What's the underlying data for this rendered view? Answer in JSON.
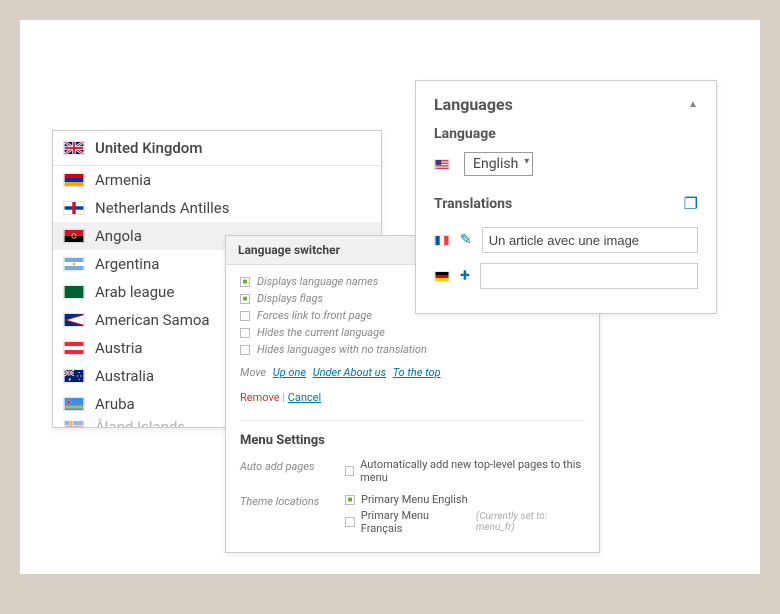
{
  "countries": {
    "header": "United Kingdom",
    "items": [
      {
        "label": "Armenia",
        "flag": "am"
      },
      {
        "label": "Netherlands Antilles",
        "flag": "an"
      },
      {
        "label": "Angola",
        "flag": "ao",
        "selected": true
      },
      {
        "label": "Argentina",
        "flag": "ar"
      },
      {
        "label": "Arab league",
        "flag": "arab"
      },
      {
        "label": "American Samoa",
        "flag": "as"
      },
      {
        "label": "Austria",
        "flag": "at"
      },
      {
        "label": "Australia",
        "flag": "au"
      },
      {
        "label": "Aruba",
        "flag": "aw"
      },
      {
        "label": "Åland Islands",
        "flag": "ax",
        "cutoff": true
      }
    ]
  },
  "switcher": {
    "title": "Language switcher",
    "opts": [
      {
        "label": "Displays language names",
        "checked": true
      },
      {
        "label": "Displays flags",
        "checked": true
      },
      {
        "label": "Forces link to front page",
        "checked": false
      },
      {
        "label": "Hides the current language",
        "checked": false
      },
      {
        "label": "Hides languages with no translation",
        "checked": false
      }
    ],
    "move_label": "Move",
    "move_links": [
      "Up one",
      "Under About us",
      "To the top"
    ],
    "remove": "Remove",
    "cancel": "Cancel"
  },
  "menu_settings": {
    "title": "Menu Settings",
    "auto_add_label": "Auto add pages",
    "auto_add_opt": "Automatically add new top-level pages to this menu",
    "theme_loc_label": "Theme locations",
    "theme_locs": [
      {
        "label": "Primary Menu English",
        "checked": true,
        "hint": ""
      },
      {
        "label": "Primary Menu Français",
        "checked": false,
        "hint": "(Currently set to: menu_fr)"
      }
    ]
  },
  "langbox": {
    "title": "Languages",
    "lang_label": "Language",
    "lang_value": "English",
    "trans_label": "Translations",
    "rows": [
      {
        "flag": "fr",
        "action": "edit",
        "value": "Un article avec une image"
      },
      {
        "flag": "de",
        "action": "add",
        "value": ""
      }
    ]
  }
}
